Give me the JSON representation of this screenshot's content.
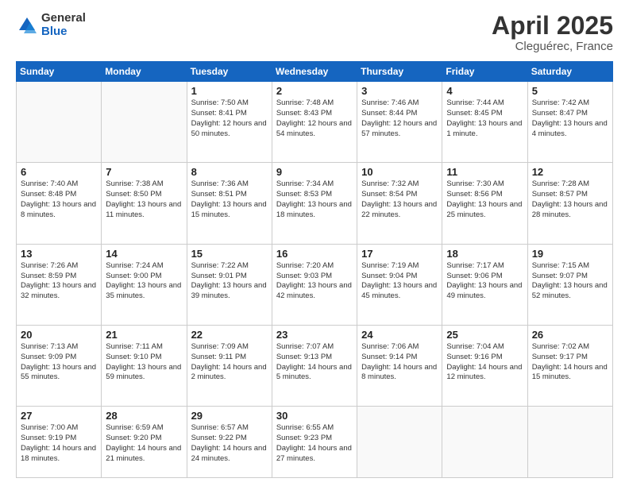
{
  "header": {
    "logo_general": "General",
    "logo_blue": "Blue",
    "title": "April 2025",
    "location": "Cleguérec, France"
  },
  "weekdays": [
    "Sunday",
    "Monday",
    "Tuesday",
    "Wednesday",
    "Thursday",
    "Friday",
    "Saturday"
  ],
  "weeks": [
    [
      {
        "day": "",
        "info": ""
      },
      {
        "day": "",
        "info": ""
      },
      {
        "day": "1",
        "info": "Sunrise: 7:50 AM\nSunset: 8:41 PM\nDaylight: 12 hours and 50 minutes."
      },
      {
        "day": "2",
        "info": "Sunrise: 7:48 AM\nSunset: 8:43 PM\nDaylight: 12 hours and 54 minutes."
      },
      {
        "day": "3",
        "info": "Sunrise: 7:46 AM\nSunset: 8:44 PM\nDaylight: 12 hours and 57 minutes."
      },
      {
        "day": "4",
        "info": "Sunrise: 7:44 AM\nSunset: 8:45 PM\nDaylight: 13 hours and 1 minute."
      },
      {
        "day": "5",
        "info": "Sunrise: 7:42 AM\nSunset: 8:47 PM\nDaylight: 13 hours and 4 minutes."
      }
    ],
    [
      {
        "day": "6",
        "info": "Sunrise: 7:40 AM\nSunset: 8:48 PM\nDaylight: 13 hours and 8 minutes."
      },
      {
        "day": "7",
        "info": "Sunrise: 7:38 AM\nSunset: 8:50 PM\nDaylight: 13 hours and 11 minutes."
      },
      {
        "day": "8",
        "info": "Sunrise: 7:36 AM\nSunset: 8:51 PM\nDaylight: 13 hours and 15 minutes."
      },
      {
        "day": "9",
        "info": "Sunrise: 7:34 AM\nSunset: 8:53 PM\nDaylight: 13 hours and 18 minutes."
      },
      {
        "day": "10",
        "info": "Sunrise: 7:32 AM\nSunset: 8:54 PM\nDaylight: 13 hours and 22 minutes."
      },
      {
        "day": "11",
        "info": "Sunrise: 7:30 AM\nSunset: 8:56 PM\nDaylight: 13 hours and 25 minutes."
      },
      {
        "day": "12",
        "info": "Sunrise: 7:28 AM\nSunset: 8:57 PM\nDaylight: 13 hours and 28 minutes."
      }
    ],
    [
      {
        "day": "13",
        "info": "Sunrise: 7:26 AM\nSunset: 8:59 PM\nDaylight: 13 hours and 32 minutes."
      },
      {
        "day": "14",
        "info": "Sunrise: 7:24 AM\nSunset: 9:00 PM\nDaylight: 13 hours and 35 minutes."
      },
      {
        "day": "15",
        "info": "Sunrise: 7:22 AM\nSunset: 9:01 PM\nDaylight: 13 hours and 39 minutes."
      },
      {
        "day": "16",
        "info": "Sunrise: 7:20 AM\nSunset: 9:03 PM\nDaylight: 13 hours and 42 minutes."
      },
      {
        "day": "17",
        "info": "Sunrise: 7:19 AM\nSunset: 9:04 PM\nDaylight: 13 hours and 45 minutes."
      },
      {
        "day": "18",
        "info": "Sunrise: 7:17 AM\nSunset: 9:06 PM\nDaylight: 13 hours and 49 minutes."
      },
      {
        "day": "19",
        "info": "Sunrise: 7:15 AM\nSunset: 9:07 PM\nDaylight: 13 hours and 52 minutes."
      }
    ],
    [
      {
        "day": "20",
        "info": "Sunrise: 7:13 AM\nSunset: 9:09 PM\nDaylight: 13 hours and 55 minutes."
      },
      {
        "day": "21",
        "info": "Sunrise: 7:11 AM\nSunset: 9:10 PM\nDaylight: 13 hours and 59 minutes."
      },
      {
        "day": "22",
        "info": "Sunrise: 7:09 AM\nSunset: 9:11 PM\nDaylight: 14 hours and 2 minutes."
      },
      {
        "day": "23",
        "info": "Sunrise: 7:07 AM\nSunset: 9:13 PM\nDaylight: 14 hours and 5 minutes."
      },
      {
        "day": "24",
        "info": "Sunrise: 7:06 AM\nSunset: 9:14 PM\nDaylight: 14 hours and 8 minutes."
      },
      {
        "day": "25",
        "info": "Sunrise: 7:04 AM\nSunset: 9:16 PM\nDaylight: 14 hours and 12 minutes."
      },
      {
        "day": "26",
        "info": "Sunrise: 7:02 AM\nSunset: 9:17 PM\nDaylight: 14 hours and 15 minutes."
      }
    ],
    [
      {
        "day": "27",
        "info": "Sunrise: 7:00 AM\nSunset: 9:19 PM\nDaylight: 14 hours and 18 minutes."
      },
      {
        "day": "28",
        "info": "Sunrise: 6:59 AM\nSunset: 9:20 PM\nDaylight: 14 hours and 21 minutes."
      },
      {
        "day": "29",
        "info": "Sunrise: 6:57 AM\nSunset: 9:22 PM\nDaylight: 14 hours and 24 minutes."
      },
      {
        "day": "30",
        "info": "Sunrise: 6:55 AM\nSunset: 9:23 PM\nDaylight: 14 hours and 27 minutes."
      },
      {
        "day": "",
        "info": ""
      },
      {
        "day": "",
        "info": ""
      },
      {
        "day": "",
        "info": ""
      }
    ]
  ]
}
